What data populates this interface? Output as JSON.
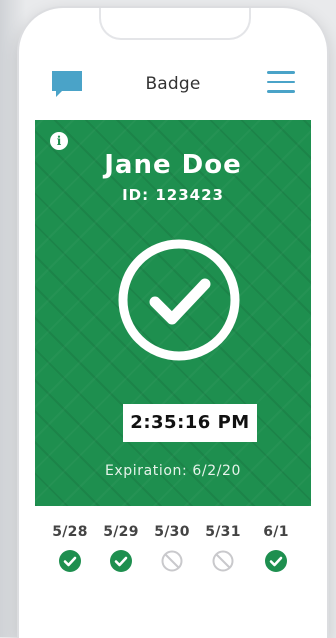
{
  "header": {
    "title": "Badge",
    "chat_icon": "chat-bubble-icon",
    "menu_icon": "hamburger-menu-icon"
  },
  "badge": {
    "name": "Jane Doe",
    "id_text": "ID: 123423",
    "time": "2:35:16 PM",
    "expiration": "Expiration: 6/2/20",
    "status_icon": "check-circle-icon",
    "info_icon": "info-icon",
    "color": "#1e8f4f"
  },
  "history": [
    {
      "date": "5/28",
      "status": "check"
    },
    {
      "date": "5/29",
      "status": "check"
    },
    {
      "date": "5/30",
      "status": "none"
    },
    {
      "date": "5/31",
      "status": "none"
    },
    {
      "date": "6/1",
      "status": "check"
    }
  ],
  "colors": {
    "accent": "#4aa3c8",
    "check": "#1e8f4f",
    "none": "#c9c9cc"
  }
}
